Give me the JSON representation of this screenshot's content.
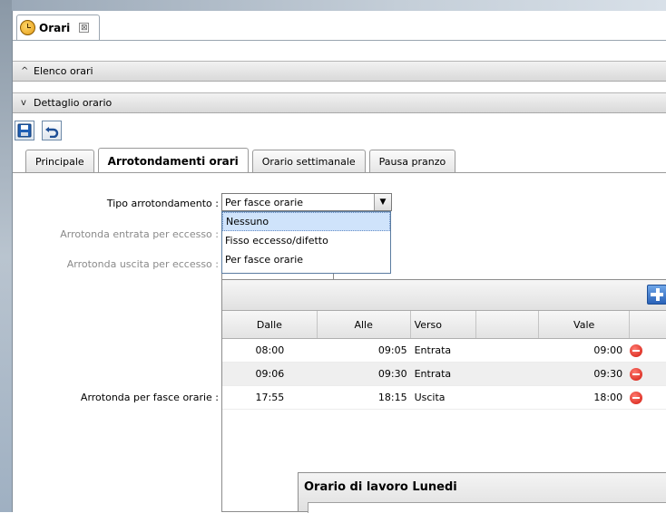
{
  "tab": {
    "title": "Orari",
    "close_glyph": "⊠"
  },
  "accordion": {
    "list_label": "Elenco orari",
    "detail_label": "Dettaglio orario",
    "collapsed_glyph": "^",
    "expanded_glyph": "v"
  },
  "toolbar": {
    "save_icon": "floppy-disk-icon",
    "undo_icon": "undo-arrow-icon"
  },
  "subtabs": [
    "Principale",
    "Arrotondamenti orari",
    "Orario settimanale",
    "Pausa pranzo"
  ],
  "active_subtab": "Arrotondamenti orari",
  "form": {
    "tipo_label": "Tipo arrotondamento :",
    "entrata_label": "Arrotonda entrata per eccesso :",
    "uscita_label": "Arrotonda uscita per eccesso :",
    "fasce_label": "Arrotonda per fasce orarie :",
    "tipo_value": "Per fasce orarie",
    "tipo_options": [
      "Nessuno",
      "Fisso eccesso/difetto",
      "Per fasce orarie"
    ],
    "highlighted_option": "Nessuno"
  },
  "grid": {
    "columns": [
      "Dalle",
      "Alle",
      "Verso",
      "",
      "Vale"
    ],
    "rows": [
      {
        "dalle": "08:00",
        "alle": "09:05",
        "verso": "Entrata",
        "vale": "09:00"
      },
      {
        "dalle": "09:06",
        "alle": "09:30",
        "verso": "Entrata",
        "vale": "09:30"
      },
      {
        "dalle": "17:55",
        "alle": "18:15",
        "verso": "Uscita",
        "vale": "18:00"
      }
    ]
  },
  "dialog": {
    "title": "Orario di lavoro Lunedi"
  },
  "colors": {
    "accent": "#2a62b8",
    "remove": "#d21a0e",
    "highlight": "#cfe3fb"
  }
}
